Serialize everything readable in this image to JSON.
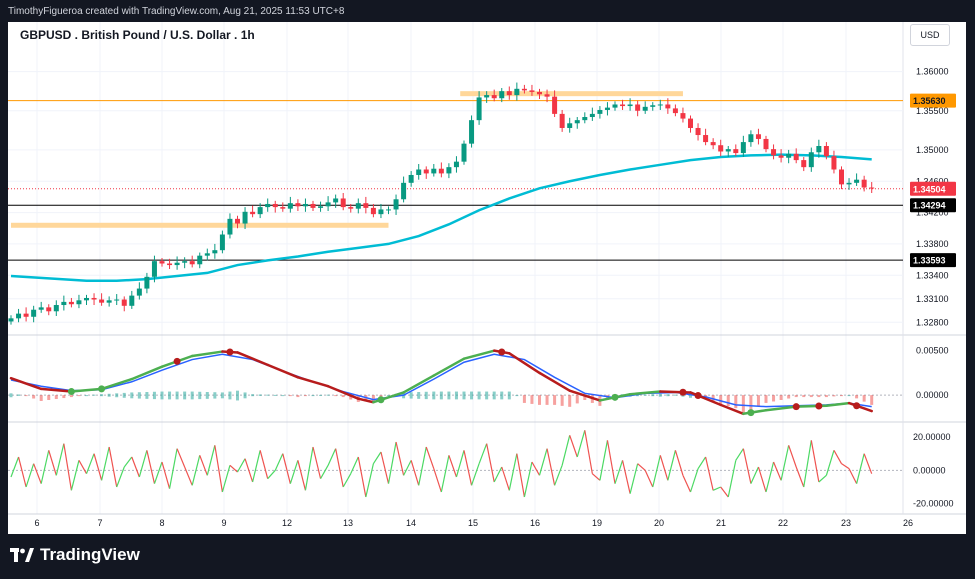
{
  "header": {
    "attribution": "TimothyFigueroa created with TradingView.com, Aug 21, 2025 11:53 UTC+8"
  },
  "chart_title": "GBPUSD . British Pound / U.S. Dollar . 1h",
  "currency_label": "USD",
  "footer": {
    "brand": "TradingView",
    "logo_icon": "tradingview-logo-icon"
  },
  "colors": {
    "up": "#089981",
    "down": "#f23645",
    "ema": "#00bcd4",
    "resistance_zone": "#ffd79a",
    "macd_green": "#4caf50",
    "macd_red": "#b71c1c",
    "macd_signal": "#2962ff",
    "rsi_green": "#4cd964",
    "rsi_red": "#ef5350",
    "orange_line": "#ff9800"
  },
  "chart_data": {
    "type": "candlestick",
    "title": "GBPUSD . British Pound / U.S. Dollar . 1h",
    "x_ticks": [
      "6",
      "7",
      "8",
      "9",
      "12",
      "13",
      "14",
      "15",
      "16",
      "19",
      "20",
      "21",
      "22",
      "23",
      "26"
    ],
    "y_ticks": [
      "1.36000",
      "1.35500",
      "1.35000",
      "1.34600",
      "1.34200",
      "1.33800",
      "1.33400",
      "1.33100",
      "1.32800"
    ],
    "ylim": [
      1.3265,
      1.3625
    ],
    "price_labels": [
      {
        "text": "1.35630",
        "value": 1.3563,
        "kind": "orange"
      },
      {
        "text": "1.34504",
        "value": 1.34504,
        "kind": "red"
      },
      {
        "text": "1.34294",
        "value": 1.34294,
        "kind": "black"
      },
      {
        "text": "1.33593",
        "value": 1.33593,
        "kind": "black"
      }
    ],
    "horizontal_lines": [
      {
        "value": 1.3563,
        "color": "#ff9800"
      },
      {
        "value": 1.34294,
        "color": "#000000"
      },
      {
        "value": 1.33593,
        "color": "#000000"
      },
      {
        "value": 1.34504,
        "color": "#f23645",
        "dashed": true
      }
    ],
    "zones": [
      {
        "x_from": 59.5,
        "x_to": 89,
        "value_low": 1.3569,
        "value_high": 1.3575
      },
      {
        "x_from": 0,
        "x_to": 50,
        "value_low": 1.3402,
        "value_high": 1.3407
      }
    ],
    "closes": [
      1.3285,
      1.3291,
      1.3287,
      1.3296,
      1.3299,
      1.3294,
      1.3302,
      1.3306,
      1.3303,
      1.3308,
      1.3311,
      1.3309,
      1.3305,
      1.3308,
      1.3309,
      1.3301,
      1.3314,
      1.3323,
      1.3338,
      1.3358,
      1.3355,
      1.3353,
      1.3356,
      1.3358,
      1.3354,
      1.3365,
      1.3368,
      1.3372,
      1.3392,
      1.3412,
      1.3406,
      1.3421,
      1.3418,
      1.3427,
      1.3431,
      1.3427,
      1.3425,
      1.3432,
      1.3428,
      1.3431,
      1.3426,
      1.3428,
      1.3433,
      1.3438,
      1.3427,
      1.3425,
      1.3432,
      1.3426,
      1.3418,
      1.3424,
      1.3424,
      1.3437,
      1.3458,
      1.3468,
      1.3475,
      1.347,
      1.3476,
      1.347,
      1.3478,
      1.3485,
      1.3508,
      1.3538,
      1.3567,
      1.357,
      1.3566,
      1.3575,
      1.357,
      1.3578,
      1.3576,
      1.3574,
      1.3571,
      1.3568,
      1.3546,
      1.3528,
      1.3534,
      1.3538,
      1.3542,
      1.3546,
      1.3551,
      1.3554,
      1.3558,
      1.3556,
      1.3558,
      1.355,
      1.3555,
      1.3557,
      1.3558,
      1.3553,
      1.3547,
      1.354,
      1.3528,
      1.3519,
      1.351,
      1.3506,
      1.3498,
      1.3501,
      1.3496,
      1.351,
      1.352,
      1.3514,
      1.3501,
      1.3493,
      1.349,
      1.3495,
      1.3487,
      1.3478,
      1.3497,
      1.3505,
      1.3492,
      1.3475,
      1.3456,
      1.3458,
      1.3462,
      1.3452,
      1.3451
    ],
    "ema": [
      [
        0,
        1.3339
      ],
      [
        10,
        1.3333
      ],
      [
        14,
        1.3333
      ],
      [
        18,
        1.3335
      ],
      [
        22,
        1.3339
      ],
      [
        26,
        1.3343
      ],
      [
        30,
        1.3353
      ],
      [
        34,
        1.3359
      ],
      [
        38,
        1.3364
      ],
      [
        42,
        1.337
      ],
      [
        46,
        1.3375
      ],
      [
        50,
        1.338
      ],
      [
        54,
        1.339
      ],
      [
        58,
        1.3405
      ],
      [
        62,
        1.3423
      ],
      [
        66,
        1.3438
      ],
      [
        70,
        1.3451
      ],
      [
        74,
        1.346
      ],
      [
        78,
        1.3468
      ],
      [
        82,
        1.3475
      ],
      [
        86,
        1.3481
      ],
      [
        90,
        1.3487
      ],
      [
        94,
        1.3491
      ],
      [
        98,
        1.3493
      ],
      [
        102,
        1.3494
      ],
      [
        106,
        1.3493
      ],
      [
        110,
        1.3491
      ],
      [
        114,
        1.3488
      ]
    ],
    "macd": {
      "yticks": [
        "0.00500",
        "0.00000"
      ],
      "ylim": [
        -0.0028,
        0.0062
      ],
      "macd_line": [
        [
          0,
          0.0019
        ],
        [
          4,
          0.0007
        ],
        [
          8,
          0.0004
        ],
        [
          12,
          0.0007
        ],
        [
          16,
          0.0018
        ],
        [
          20,
          0.0032
        ],
        [
          24,
          0.0044
        ],
        [
          28,
          0.0049
        ],
        [
          30,
          0.0048
        ],
        [
          34,
          0.0034
        ],
        [
          38,
          0.002
        ],
        [
          42,
          0.001
        ],
        [
          46,
          -0.0004
        ],
        [
          48,
          -0.0008
        ],
        [
          52,
          0.0003
        ],
        [
          56,
          0.0022
        ],
        [
          60,
          0.0041
        ],
        [
          64,
          0.005
        ],
        [
          66,
          0.0047
        ],
        [
          70,
          0.0025
        ],
        [
          74,
          0.0005
        ],
        [
          78,
          -0.0006
        ],
        [
          82,
          0.0001
        ],
        [
          86,
          0.0004
        ],
        [
          90,
          0.0003
        ],
        [
          94,
          -0.0011
        ],
        [
          97,
          -0.0021
        ],
        [
          100,
          -0.0017
        ],
        [
          104,
          -0.0013
        ],
        [
          108,
          -0.0012
        ],
        [
          111,
          -0.0009
        ],
        [
          114,
          -0.0018
        ]
      ],
      "signal_line": [
        [
          0,
          0.0017
        ],
        [
          4,
          0.001
        ],
        [
          8,
          0.0005
        ],
        [
          12,
          0.0006
        ],
        [
          16,
          0.0015
        ],
        [
          20,
          0.0028
        ],
        [
          24,
          0.004
        ],
        [
          28,
          0.0046
        ],
        [
          32,
          0.004
        ],
        [
          36,
          0.0027
        ],
        [
          40,
          0.0015
        ],
        [
          44,
          0.0004
        ],
        [
          48,
          -0.0005
        ],
        [
          52,
          0.0
        ],
        [
          56,
          0.0018
        ],
        [
          60,
          0.0037
        ],
        [
          64,
          0.0046
        ],
        [
          68,
          0.004
        ],
        [
          72,
          0.002
        ],
        [
          76,
          0.0002
        ],
        [
          80,
          -0.0003
        ],
        [
          84,
          0.0002
        ],
        [
          88,
          0.0003
        ],
        [
          92,
          -0.0002
        ],
        [
          96,
          -0.0011
        ],
        [
          100,
          -0.0013
        ],
        [
          104,
          -0.0012
        ],
        [
          108,
          -0.0011
        ],
        [
          111,
          -0.0009
        ],
        [
          114,
          -0.0013
        ]
      ],
      "cross_markers": [
        {
          "x": 8,
          "color": "green"
        },
        {
          "x": 12,
          "color": "green"
        },
        {
          "x": 22,
          "color": "red"
        },
        {
          "x": 29,
          "color": "red"
        },
        {
          "x": 49,
          "color": "green"
        },
        {
          "x": 65,
          "color": "red"
        },
        {
          "x": 80,
          "color": "green"
        },
        {
          "x": 89,
          "color": "red"
        },
        {
          "x": 91,
          "color": "red"
        },
        {
          "x": 98,
          "color": "green"
        },
        {
          "x": 104,
          "color": "red"
        },
        {
          "x": 107,
          "color": "red"
        },
        {
          "x": 112,
          "color": "red"
        }
      ]
    },
    "oscillator": {
      "yticks": [
        "20.00000",
        "0.00000",
        "-20.00000"
      ],
      "ylim": [
        -25,
        26
      ],
      "values": [
        -4,
        8,
        -10,
        4,
        -8,
        12,
        -3,
        16,
        -12,
        6,
        -2,
        10,
        -6,
        14,
        -10,
        2,
        8,
        -4,
        12,
        -8,
        5,
        -11,
        13,
        2,
        -9,
        9,
        -3,
        15,
        -13,
        3,
        -1,
        7,
        -7,
        12,
        -5,
        0,
        10,
        -8,
        6,
        -12,
        14,
        -5,
        3,
        13,
        -10,
        -2,
        8,
        -16,
        4,
        11,
        -8,
        17,
        -3,
        6,
        -9,
        14,
        1,
        -13,
        9,
        -4,
        12,
        -9,
        4,
        16,
        -7,
        2,
        -12,
        10,
        -16,
        5,
        -3,
        13,
        -9,
        3,
        21,
        8,
        24,
        -2,
        -6,
        18,
        -8,
        6,
        -14,
        4,
        0,
        -10,
        9,
        -6,
        12,
        -3,
        -13,
        1,
        8,
        -12,
        -10,
        -16,
        6,
        13,
        -8,
        2,
        -13,
        5,
        -6,
        15,
        2,
        -10,
        18,
        -7,
        -3,
        12,
        4,
        1,
        -8,
        10,
        -2
      ]
    }
  }
}
